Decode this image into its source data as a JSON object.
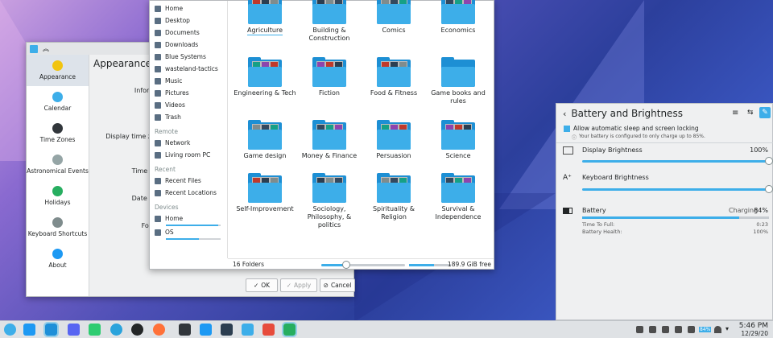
{
  "settings_window": {
    "title": "Appearance",
    "sidebar": [
      {
        "label": "Appearance",
        "icon": "palette-icon",
        "color": "#f1c40f",
        "active": true
      },
      {
        "label": "Calendar",
        "icon": "calendar-icon",
        "color": "#3daee9"
      },
      {
        "label": "Time Zones",
        "icon": "globe-icon",
        "color": "#31363b"
      },
      {
        "label": "Astronomical Events",
        "icon": "moon-icon",
        "color": "#95a5a6"
      },
      {
        "label": "Holidays",
        "icon": "flag-icon",
        "color": "#27ae60"
      },
      {
        "label": "Keyboard Shortcuts",
        "icon": "keyboard-icon",
        "color": "#7f8c8d"
      },
      {
        "label": "About",
        "icon": "info-icon",
        "color": "#1d99f3"
      }
    ],
    "form_labels": [
      "Inform",
      "Display time zo",
      "Time di",
      "Date fo",
      "Font"
    ],
    "buttons": {
      "ok": "OK",
      "apply": "Apply",
      "cancel": "Cancel"
    }
  },
  "dolphin": {
    "places": [
      {
        "label": "Home",
        "icon": "home-icon"
      },
      {
        "label": "Desktop",
        "icon": "desktop-icon"
      },
      {
        "label": "Documents",
        "icon": "documents-icon"
      },
      {
        "label": "Downloads",
        "icon": "downloads-icon"
      },
      {
        "label": "Blue Systems",
        "icon": "folder-icon"
      },
      {
        "label": "wasteland-tactics",
        "icon": "folder-icon"
      },
      {
        "label": "Music",
        "icon": "music-icon"
      },
      {
        "label": "Pictures",
        "icon": "pictures-icon"
      },
      {
        "label": "Videos",
        "icon": "videos-icon"
      },
      {
        "label": "Trash",
        "icon": "trash-icon"
      }
    ],
    "remote_header": "Remote",
    "remote": [
      {
        "label": "Network",
        "icon": "network-icon"
      },
      {
        "label": "Living room PC",
        "icon": "computer-icon"
      }
    ],
    "recent_header": "Recent",
    "recent": [
      {
        "label": "Recent Files",
        "icon": "recent-files-icon"
      },
      {
        "label": "Recent Locations",
        "icon": "recent-locations-icon"
      }
    ],
    "devices_header": "Devices",
    "devices": [
      {
        "label": "Home",
        "icon": "drive-icon",
        "usage": 0.95
      },
      {
        "label": "OS",
        "icon": "drive-icon",
        "usage": 0.6
      }
    ],
    "folders": [
      "Agriculture",
      "Building & Construction",
      "Comics",
      "Economics",
      "Engineering & Tech",
      "Fiction",
      "Food & Fitness",
      "Game books and rules",
      "Game design",
      "Money & Finance",
      "Persuasion",
      "Science",
      "Self-Improvement",
      "Sociology, Philosophy,  & politics",
      "Spirituality & Religion",
      "Survival & Independence"
    ],
    "status": {
      "count": "16 Folders",
      "free": "189.9 GiB free",
      "zoom": 0.3,
      "space_used": 0.6
    }
  },
  "battery_popup": {
    "title": "Battery and Brightness",
    "auto_sleep_label": "Allow automatic sleep and screen locking",
    "charge_note": "Your battery is configured to only charge up to 85%.",
    "display_brightness": {
      "label": "Display Brightness",
      "value": "100%",
      "level": 1.0
    },
    "keyboard_brightness": {
      "label": "Keyboard Brightness",
      "level": 1.0
    },
    "battery": {
      "label": "Battery",
      "state": "Charging",
      "percent": "84%",
      "level": 0.84,
      "time_label": "Time To Full:",
      "time_value": "0:23",
      "health_label": "Battery Health:",
      "health_value": "100%"
    }
  },
  "taskbar": {
    "time": "5:46 PM",
    "date": "12/29/20",
    "battery_badge": "84%"
  }
}
